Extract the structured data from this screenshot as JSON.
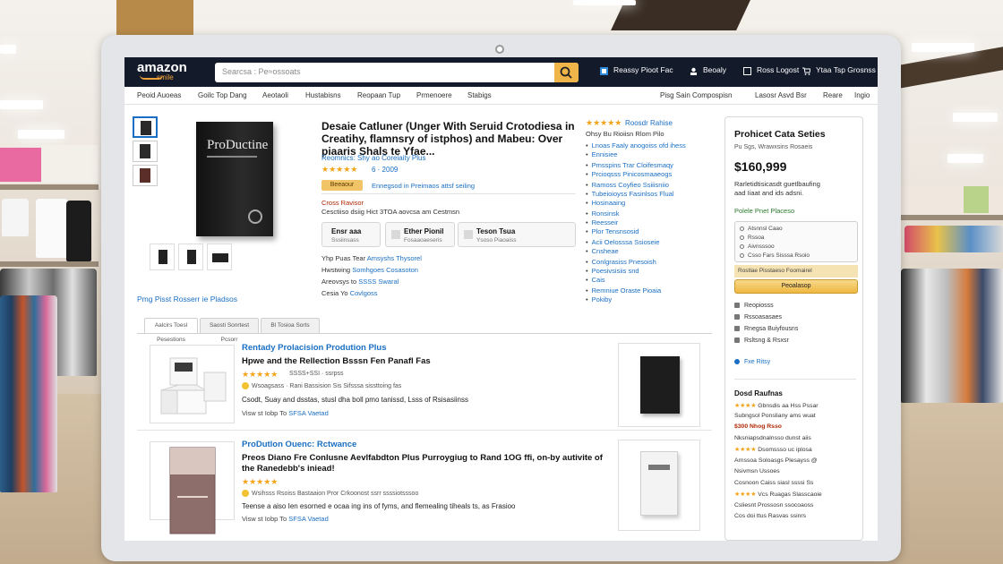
{
  "header": {
    "logo": "amazon",
    "logo_sub": "smile",
    "search_placeholder": "Searcsa : Pe≈ossoats",
    "nav": [
      {
        "label": "Reassy Pioot Fac",
        "icon": "gift-icon"
      },
      {
        "label": "Beoaly",
        "icon": "user-icon"
      },
      {
        "label": "Ross Logost",
        "icon": "account-icon"
      },
      {
        "label": "Ytaa Tsp Grosnss",
        "icon": "cart-icon"
      }
    ]
  },
  "subnav": {
    "left": [
      "Peoid Auoeas",
      "Goilc Top Dang",
      "Aeotaoli",
      "Hustabisns",
      "Reopaan Tup",
      "Prmenoere",
      "Stabigs"
    ],
    "right": [
      "Pisg Sain Compospisn",
      "Lasosr Asvd Bsr",
      "Reare",
      "Ingio"
    ]
  },
  "product": {
    "book_cover_text": "ProDuctine",
    "title": "Desaie Catluner (Unger With Seruid Crotodiesa in Creatihy, flamnsry of istphos) and Mabeu: Over piaaris Shals te Yfae...",
    "brand": "Reomnics: Shy ao Coreiaity Plus",
    "stars": "★★★★★",
    "rating_count": "6 · 2009",
    "badge": "Beeaour",
    "badge_text": "Ennegsod in Preimaos attsf seiling",
    "stock": "Cross Ravisor",
    "delivery": "Cesctiiso dsiig Hict 3TOA aovcsa am Cestmsn",
    "options": [
      {
        "title": "Ensr aaa",
        "sub": "Sssiinsass"
      },
      {
        "title": "Ether Pionil",
        "sub": "Fosaaoaeseris"
      },
      {
        "title": "Teson Tsua",
        "sub": "Ysoso Piaoaiss"
      }
    ],
    "details": [
      {
        "label": "Yhp Puas Tear",
        "value": "Amsyshs Thysorel"
      },
      {
        "label": "Hwstwing",
        "value": "Somhgoes Cosasoton"
      },
      {
        "label": "Areovsys to",
        "value": "SSSS Swaral"
      },
      {
        "label": "Cesia Yo",
        "value": "Covlgoss"
      }
    ],
    "aside_stars": "★★★★★",
    "aside_rating": "Roosdr Rahise",
    "aside_sub": "Ohsy Bu Rioiisn Rlom Pilo",
    "bullets": [
      "Lnoas Faaly anogoiss ofd ihess",
      "Ennisiee",
      "Pmsspins Trar Cloifesmaqy",
      "Prcioqsss Pinicosmaaeogs",
      "Ramoss Coyfieo Ssiiisniio",
      "Tubeioioyss Fasinlsos Flual",
      "Hosinaaing",
      "Ronsinsk",
      "Reesseir",
      "Plor Tensnsosid",
      "Acii Oelosssa Ssioseie",
      "Cnsheae",
      "Conlgrasiss Pnesoish",
      "Poesivsisiis snd",
      "Cais",
      "Remniue Oraste Pioaia",
      "Pokiby"
    ]
  },
  "buybox": {
    "title": "Prohicet Cata Seties",
    "sub": "Pu Sgs, Wrawxsins Rosaeis",
    "price": "$160,999",
    "lines": [
      "Rarletidtisicasdt guetlbaufing",
      "aad Iiaat and ids adsni."
    ],
    "green": "Polele  Pnet Placeso",
    "panel": [
      "Atsnnsl Caao",
      "Rssoa",
      "Aivnsssoo",
      "Csso Fars Sisssa Rsoio"
    ],
    "note": "Rostlae Pisstaeso Foomairel",
    "button": "Peoalasop",
    "actions": [
      "Reopiosss",
      "Rssoasasaes",
      "Rnegsa Buiyfousns",
      "Rsltsng & Rsxsr"
    ],
    "link": "Fxe Ritsy",
    "sec": "Dosd Raufnas",
    "small": [
      "Gbnsdis aa Hss Pssar",
      "Subngsol  Ponsliany ams wuat",
      "$300  Nhog Rsso",
      "Nksniapsdnalnsso dunst aiis",
      "Dsomssso uc iplosa",
      "Arnssoa Soloasgs Plesayss @",
      "Nsivmsn Ussoes",
      "Cosnoon Caiss siasl ssssi Ss",
      "Vcs Ruagas Slasscaoie",
      "Csliesnt Prossosn ssocoaoss",
      "Cos doi ttus Rasvas ssinrs"
    ]
  },
  "related": {
    "link": "Pmg Pisst Rosserr ie Pladsos",
    "tabs": [
      "Aalcirs Toesl Pesestions",
      "Saosti Sonrtest Pcsorr",
      "Bl Tosioa Sorts"
    ]
  },
  "results": [
    {
      "title": "Rentady Prolacision Prodution Plus",
      "subtitle": "Hpwe and the Rellection Bsssn Fen Panafl Fas",
      "stars": "★★★★★",
      "meta": "SSSS+SSI · ssrpss",
      "badge": "Wsoagsass · Rani Bassision Sis Sifsssa sissttoing fas",
      "desc": "Csodt, Suay and dsstas, stusl dha boll pmo tanissd, Lsss of Rsisasiinss",
      "more": "Visw st Iobp To",
      "more_link": "SFSA Vaetad"
    },
    {
      "title": "ProDutlon Ouenc: Rctwance",
      "subtitle": "Preos Diano Fre Conlusne Aevlfabdton Plus Purroygiug to Rand 1OG ffi, on-by autivite of the Ranedebb's iniead!",
      "stars": "★★★★★",
      "meta": "SSSS+SSI · ssrpss",
      "badge": "Wsihsss Rsoiss Bastaaion Pror Crkoonost ssrr ssssiotsssoo",
      "desc": "Teense a aiso Ien esorned e ocaa ing ins of fyms, and flemealing tiheals ts, as Frasioo",
      "more": "Visw st Iobp To",
      "more_link": "SFSA Vaetad"
    }
  ]
}
